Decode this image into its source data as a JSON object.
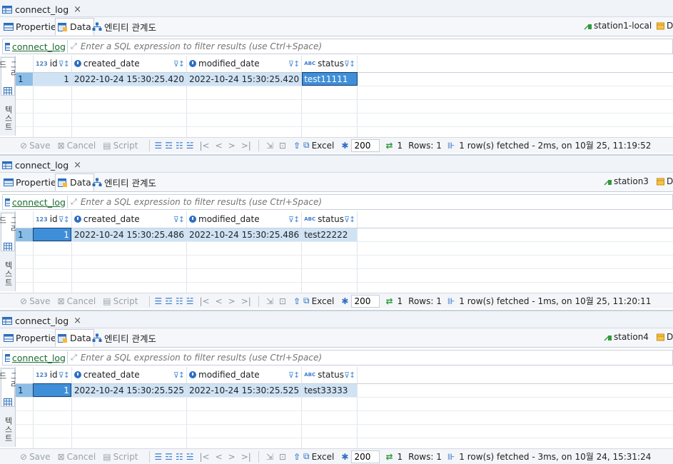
{
  "panels": [
    {
      "tab_title": "connect_log",
      "subtabs": [
        "Properties",
        "Data",
        "엔티티 관계도"
      ],
      "connection": "station1-local",
      "connection_extra": "D",
      "table_name": "connect_log",
      "filter_placeholder": "Enter a SQL expression to filter results (use Ctrl+Space)",
      "columns": [
        "id",
        "created_date",
        "modified_date",
        "status"
      ],
      "column_types": [
        "123",
        "clock",
        "clock",
        "ABC"
      ],
      "rows": [
        {
          "num": "1",
          "id": "1",
          "created_date": "2022-10-24 15:30:25.420",
          "modified_date": "2022-10-24 15:30:25.420",
          "status": "test11111"
        }
      ],
      "selected_column": "status",
      "side_tabs": [
        "그리드",
        "텍스트"
      ],
      "toolbar": {
        "save": "Save",
        "cancel": "Cancel",
        "script": "Script",
        "excel": "Excel",
        "fetch_size": "200",
        "refresh_count": "1",
        "rows": "Rows: 1",
        "status": "1 row(s) fetched - 2ms, on 10월 25, 11:19:52"
      }
    },
    {
      "tab_title": "connect_log",
      "subtabs": [
        "Properties",
        "Data",
        "엔티티 관계도"
      ],
      "connection": "station3",
      "connection_extra": "D",
      "table_name": "connect_log",
      "filter_placeholder": "Enter a SQL expression to filter results (use Ctrl+Space)",
      "columns": [
        "id",
        "created_date",
        "modified_date",
        "status"
      ],
      "column_types": [
        "123",
        "clock",
        "clock",
        "ABC"
      ],
      "rows": [
        {
          "num": "1",
          "id": "1",
          "created_date": "2022-10-24 15:30:25.486",
          "modified_date": "2022-10-24 15:30:25.486",
          "status": "test22222"
        }
      ],
      "selected_column": "id",
      "side_tabs": [
        "그리드",
        "텍스트"
      ],
      "toolbar": {
        "save": "Save",
        "cancel": "Cancel",
        "script": "Script",
        "excel": "Excel",
        "fetch_size": "200",
        "refresh_count": "1",
        "rows": "Rows: 1",
        "status": "1 row(s) fetched - 1ms, on 10월 25, 11:20:11"
      }
    },
    {
      "tab_title": "connect_log",
      "subtabs": [
        "Properties",
        "Data",
        "엔티티 관계도"
      ],
      "connection": "station4",
      "connection_extra": "D",
      "table_name": "connect_log",
      "filter_placeholder": "Enter a SQL expression to filter results (use Ctrl+Space)",
      "columns": [
        "id",
        "created_date",
        "modified_date",
        "status"
      ],
      "column_types": [
        "123",
        "clock",
        "clock",
        "ABC"
      ],
      "rows": [
        {
          "num": "1",
          "id": "1",
          "created_date": "2022-10-24 15:30:25.525",
          "modified_date": "2022-10-24 15:30:25.525",
          "status": "test33333"
        }
      ],
      "selected_column": "id",
      "side_tabs": [
        "그리드",
        "텍스트"
      ],
      "toolbar": {
        "save": "Save",
        "cancel": "Cancel",
        "script": "Script",
        "excel": "Excel",
        "fetch_size": "200",
        "refresh_count": "1",
        "rows": "Rows: 1",
        "status": "1 row(s) fetched - 3ms, on 10월 24, 15:31:24"
      }
    }
  ]
}
